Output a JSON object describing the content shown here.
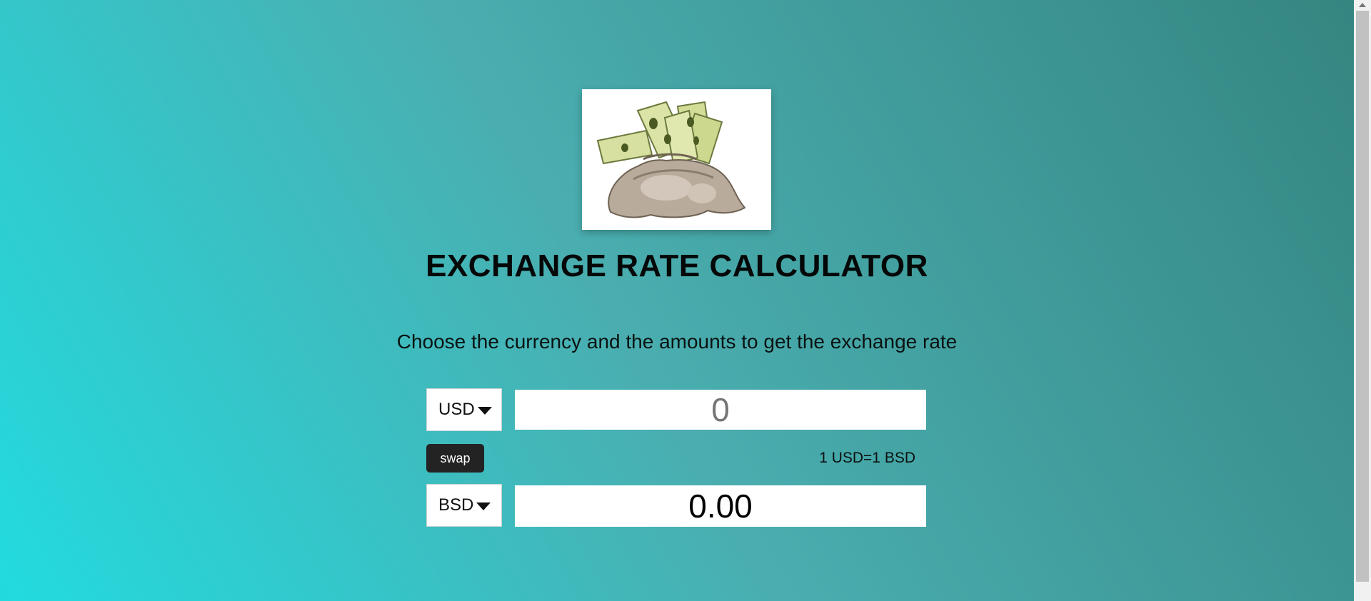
{
  "logo": {
    "icon": "money-bag-icon"
  },
  "title": "EXCHANGE RATE CALCULATOR",
  "subtitle": "Choose the currency and the amounts to get the exchange rate",
  "from": {
    "currency": "USD",
    "amount_placeholder": "0"
  },
  "to": {
    "currency": "BSD",
    "amount_value": "0.00"
  },
  "swap_label": "swap",
  "rate_text": "1 USD=1 BSD"
}
